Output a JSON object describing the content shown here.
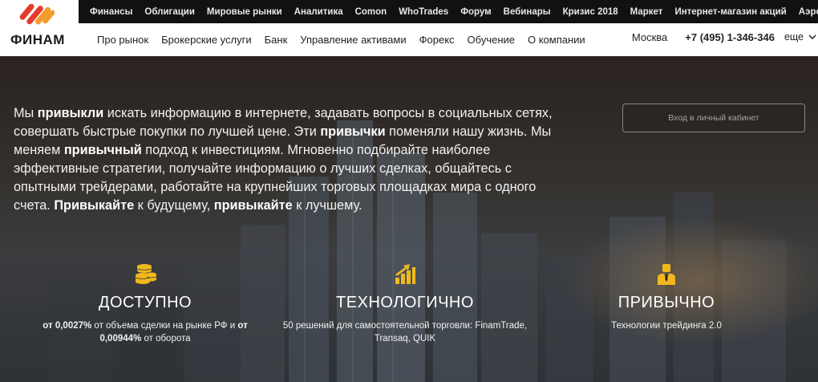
{
  "top_nav": [
    "Финансы",
    "Облигации",
    "Мировые рынки",
    "Аналитика",
    "Comon",
    "WhoTrades",
    "Форум",
    "Вебинары",
    "Кризис 2018",
    "Маркет",
    "Интернет-магазин акций",
    "Аэро"
  ],
  "logo": {
    "text": "ФИНАМ"
  },
  "main_nav": [
    "Про рынок",
    "Брокерские услуги",
    "Банк",
    "Управление активами",
    "Форекс",
    "Обучение",
    "О компании"
  ],
  "header_right": {
    "city": "Москва",
    "phone": "+7 (495) 1-346-346",
    "more": "еще"
  },
  "intro": [
    {
      "t": "Мы ",
      "b": false
    },
    {
      "t": "привыкли",
      "b": true
    },
    {
      "t": " искать информацию в интернете, задавать вопросы в социальных сетях, совершать быстрые покупки по лучшей цене. Эти ",
      "b": false
    },
    {
      "t": "привычки",
      "b": true
    },
    {
      "t": " поменяли нашу жизнь. Мы меняем ",
      "b": false
    },
    {
      "t": "привычный",
      "b": true
    },
    {
      "t": " подход к инвестициям. Мгновенно подбирайте наиболее эффективные стратегии, получайте информацию о лучших сделках, общайтесь с опытными трейдерами, работайте на крупнейших торговых площадках мира с одного счета. ",
      "b": false
    },
    {
      "t": "Привыкайте",
      "b": true
    },
    {
      "t": " к будущему, ",
      "b": false
    },
    {
      "t": "привыкайте",
      "b": true
    },
    {
      "t": " к лучшему.",
      "b": false
    }
  ],
  "login_button": "Вход в личный кабинет",
  "features": [
    {
      "title": "ДОСТУПНО",
      "icon": "coins-icon",
      "desc": [
        {
          "t": "от 0,0027%",
          "b": true
        },
        {
          "t": " от объема сделки на рынке РФ и ",
          "b": false
        },
        {
          "t": "от 0,00944%",
          "b": true
        },
        {
          "t": " от оборота",
          "b": false
        }
      ]
    },
    {
      "title": "ТЕХНОЛОГИЧНО",
      "icon": "growth-chart-icon",
      "desc": [
        {
          "t": "50 решений для самостоятельной торговли: FinamTrade, Transaq, QUIK",
          "b": false
        }
      ]
    },
    {
      "title": "ПРИВЫЧНО",
      "icon": "businessman-icon",
      "desc": [
        {
          "t": "Технологии трейдинга 2.0",
          "b": false
        }
      ]
    }
  ],
  "colors": {
    "accent": "#f0b81d",
    "logo_red": "#e53b2c",
    "logo_orange": "#f39c2c",
    "topbar": "#111111"
  }
}
